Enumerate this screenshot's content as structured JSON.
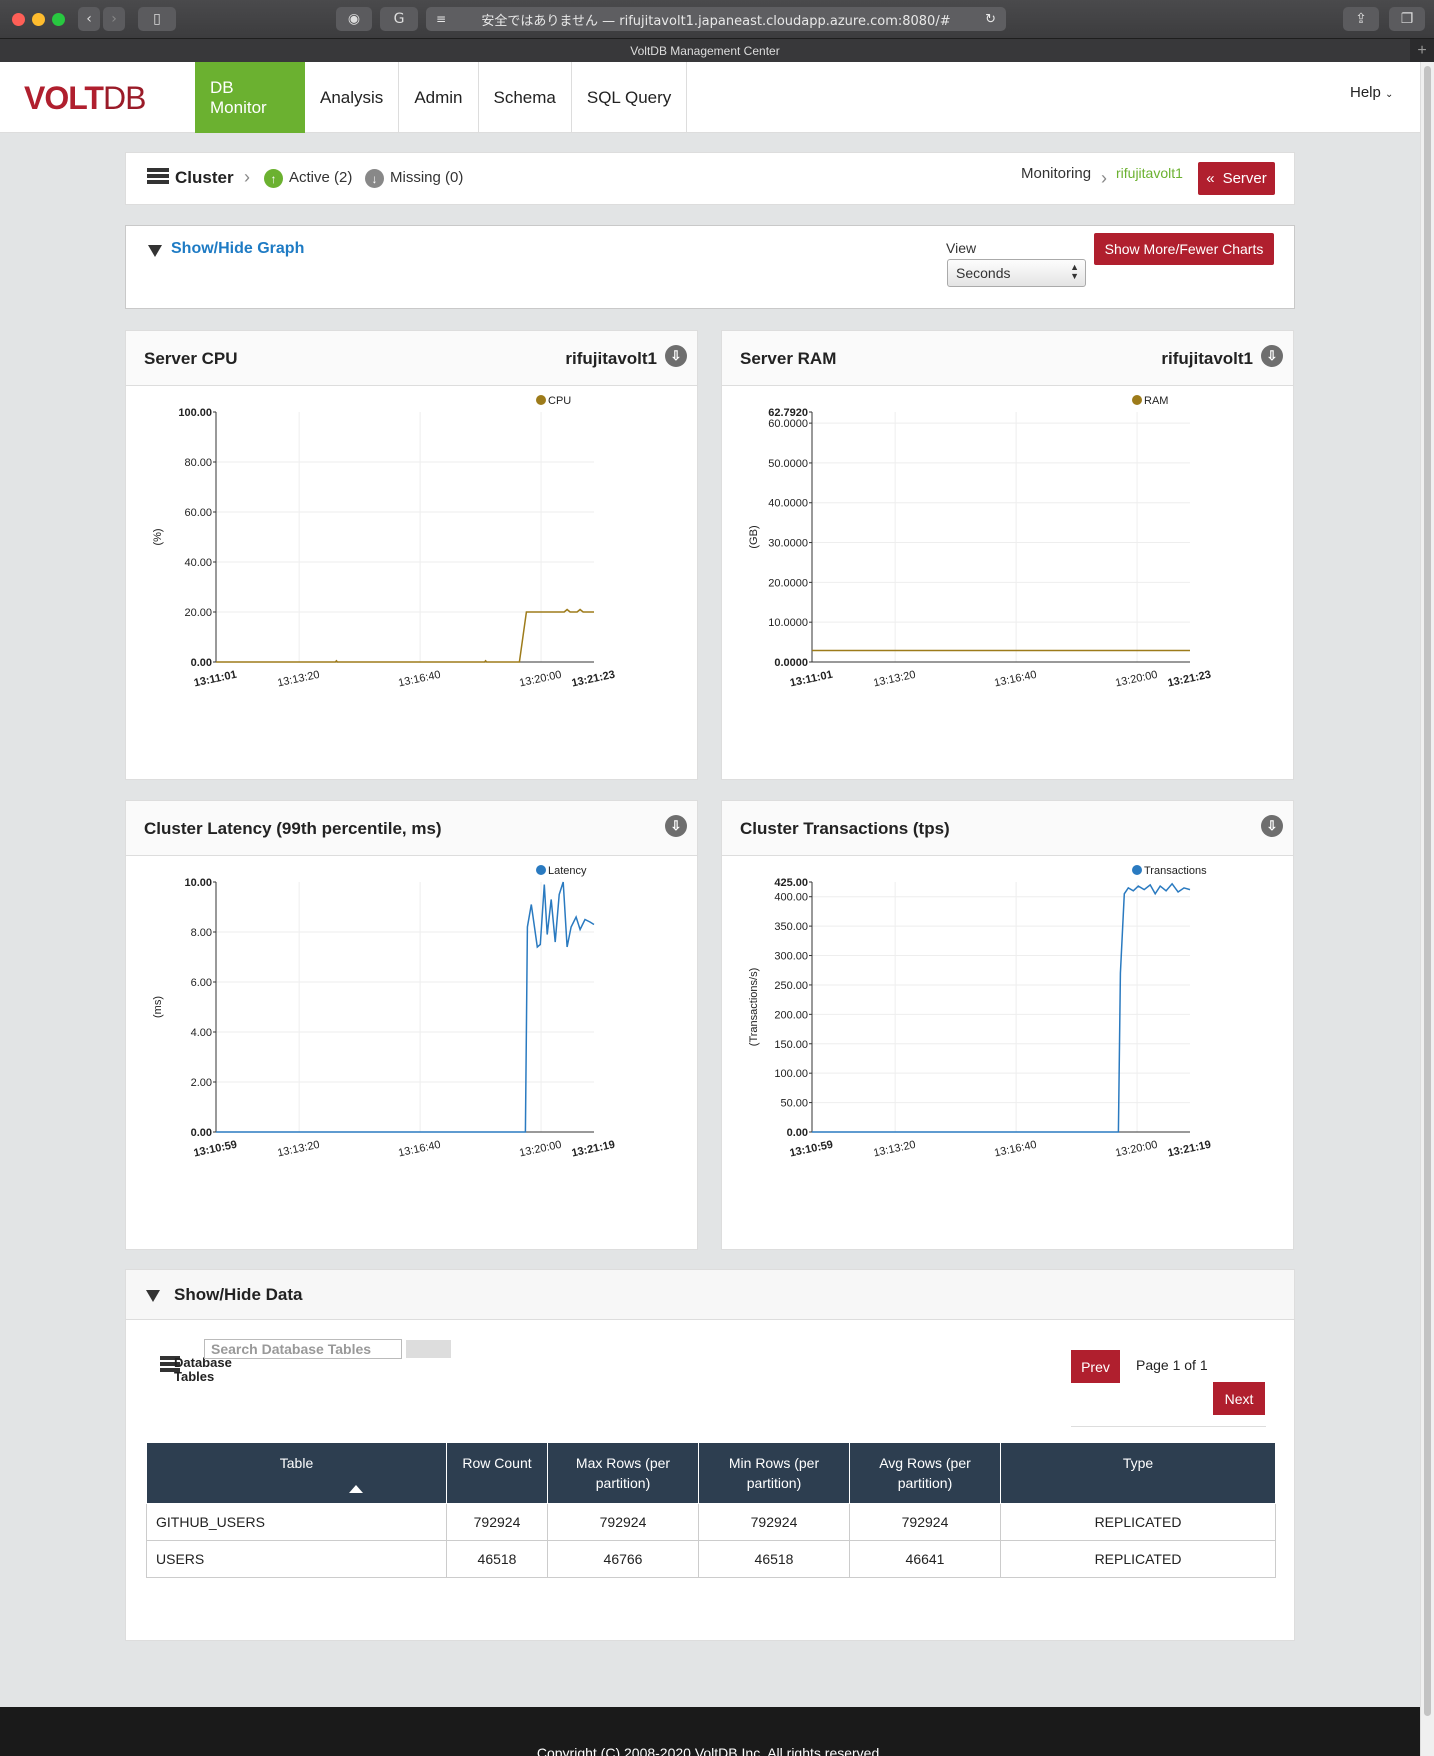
{
  "browser": {
    "url": "安全ではありません — rifujitavolt1.japaneast.cloudapp.azure.com:8080/#",
    "tab_title": "VoltDB Management Center"
  },
  "header": {
    "logo_volt": "VOLT",
    "logo_db": "DB",
    "nav": [
      "DB Monitor",
      "Analysis",
      "Admin",
      "Schema",
      "SQL Query"
    ],
    "active_nav": "DB Monitor",
    "help": "Help"
  },
  "cluster": {
    "title": "Cluster",
    "active": "Active (2)",
    "missing": "Missing (0)",
    "monitoring": "Monitoring",
    "server_name": "rifujitavolt1",
    "server_button": "Server"
  },
  "graph_controls": {
    "toggle": "Show/Hide Graph",
    "view_label": "View",
    "view_value": "Seconds",
    "more_button": "Show More/Fewer Charts"
  },
  "chart_data": [
    {
      "type": "line",
      "title": "Server CPU",
      "server": "rifujitavolt1",
      "ylabel": "(%)",
      "ylim": [
        0,
        100
      ],
      "yticks": [
        "0.00",
        "20.00",
        "40.00",
        "60.00",
        "80.00",
        "100.00"
      ],
      "xticks": [
        "13:11:01",
        "13:13:20",
        "13:16:40",
        "13:20:00",
        "13:21:23"
      ],
      "series": [
        {
          "name": "CPU",
          "color": "#9d7b1a",
          "points": [
            [
              0,
              0
            ],
            [
              100,
              0
            ],
            [
              120,
              0
            ],
            [
              121,
              0.5
            ],
            [
              122,
              0
            ],
            [
              270,
              0
            ],
            [
              271,
              0.5
            ],
            [
              272,
              0
            ],
            [
              305,
              0
            ],
            [
              312,
              20
            ],
            [
              350,
              20
            ],
            [
              353,
              21
            ],
            [
              356,
              20
            ],
            [
              363,
              20
            ],
            [
              366,
              21
            ],
            [
              369,
              20
            ],
            [
              380,
              20
            ]
          ]
        }
      ],
      "xmax": 380
    },
    {
      "type": "line",
      "title": "Server RAM",
      "server": "rifujitavolt1",
      "ylabel": "(GB)",
      "ylim": [
        0,
        62.792
      ],
      "yticks": [
        "0.0000",
        "10.0000",
        "20.0000",
        "30.0000",
        "40.0000",
        "50.0000",
        "60.0000",
        "62.7920"
      ],
      "xticks": [
        "13:11:01",
        "13:13:20",
        "13:16:40",
        "13:20:00",
        "13:21:23"
      ],
      "series": [
        {
          "name": "RAM",
          "color": "#9d7b1a",
          "points": [
            [
              0,
              2.9
            ],
            [
              380,
              2.9
            ]
          ]
        }
      ],
      "xmax": 380
    },
    {
      "type": "line",
      "title": "Cluster Latency (99th percentile, ms)",
      "server": "",
      "ylabel": "(ms)",
      "ylim": [
        0,
        10
      ],
      "yticks": [
        "0.00",
        "2.00",
        "4.00",
        "6.00",
        "8.00",
        "10.00"
      ],
      "xticks": [
        "13:10:59",
        "13:13:20",
        "13:16:40",
        "13:20:00",
        "13:21:19"
      ],
      "series": [
        {
          "name": "Latency",
          "color": "#2a7ac0",
          "points": [
            [
              0,
              0
            ],
            [
              311,
              0
            ],
            [
              313,
              8.2
            ],
            [
              317,
              9.1
            ],
            [
              323,
              7.4
            ],
            [
              326,
              7.5
            ],
            [
              330,
              9.9
            ],
            [
              333,
              7.9
            ],
            [
              337,
              9.3
            ],
            [
              341,
              7.6
            ],
            [
              345,
              9.5
            ],
            [
              349,
              10
            ],
            [
              353,
              7.4
            ],
            [
              357,
              8.2
            ],
            [
              362,
              8.6
            ],
            [
              366,
              8.1
            ],
            [
              371,
              8.5
            ],
            [
              376,
              8.4
            ],
            [
              380,
              8.3
            ]
          ]
        }
      ],
      "xmax": 380
    },
    {
      "type": "line",
      "title": "Cluster Transactions (tps)",
      "server": "",
      "ylabel": "(Transactions/s)",
      "ylim": [
        0,
        425
      ],
      "yticks": [
        "0.00",
        "50.00",
        "100.00",
        "150.00",
        "200.00",
        "250.00",
        "300.00",
        "350.00",
        "400.00",
        "425.00"
      ],
      "xticks": [
        "13:10:59",
        "13:13:20",
        "13:16:40",
        "13:20:00",
        "13:21:19"
      ],
      "series": [
        {
          "name": "Transactions",
          "color": "#2a7ac0",
          "points": [
            [
              0,
              0
            ],
            [
              308,
              0
            ],
            [
              310,
              270
            ],
            [
              314,
              405
            ],
            [
              318,
              415
            ],
            [
              323,
              410
            ],
            [
              328,
              418
            ],
            [
              334,
              412
            ],
            [
              340,
              420
            ],
            [
              345,
              405
            ],
            [
              350,
              418
            ],
            [
              356,
              410
            ],
            [
              362,
              422
            ],
            [
              368,
              408
            ],
            [
              374,
              415
            ],
            [
              380,
              412
            ]
          ]
        }
      ],
      "xmax": 380
    }
  ],
  "data_section": {
    "toggle": "Show/Hide Data",
    "label": "Database Tables",
    "search_placeholder": "Search Database Tables",
    "prev": "Prev",
    "page": "Page 1 of 1",
    "next": "Next",
    "columns": [
      "Table",
      "Row Count",
      "Max Rows (per partition)",
      "Min Rows (per partition)",
      "Avg Rows (per partition)",
      "Type"
    ],
    "rows": [
      [
        "GITHUB_USERS",
        "792924",
        "792924",
        "792924",
        "792924",
        "REPLICATED"
      ],
      [
        "USERS",
        "46518",
        "46766",
        "46518",
        "46641",
        "REPLICATED"
      ]
    ]
  },
  "footer": "Copyright (C) 2008-2020 VoltDB Inc. All rights reserved."
}
